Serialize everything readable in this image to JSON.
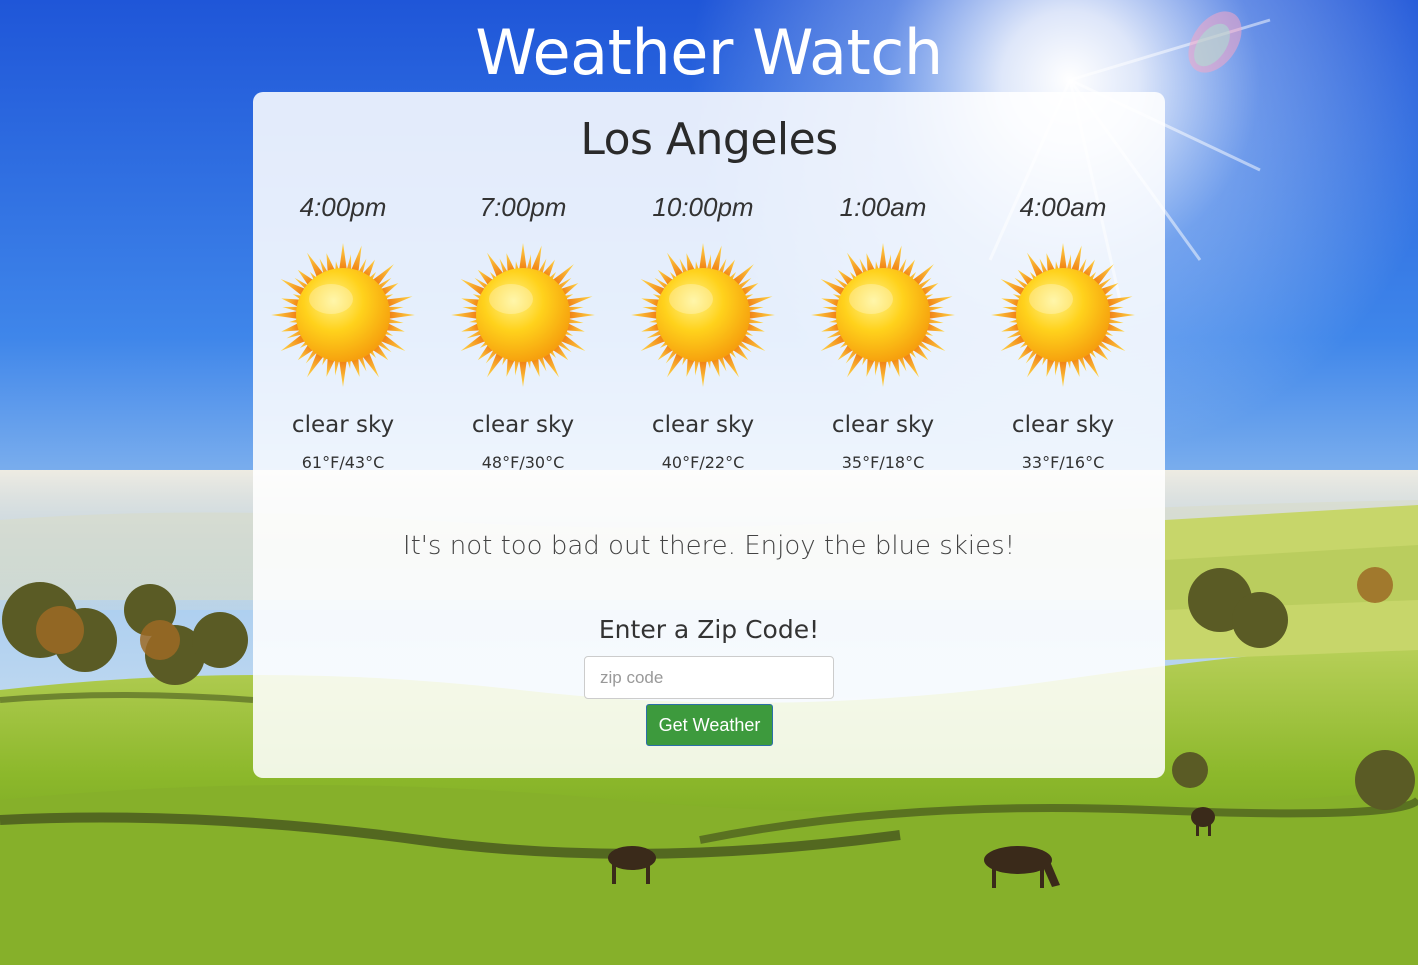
{
  "app_title": "Weather Watch",
  "city": "Los Angeles",
  "forecast": [
    {
      "time": "4:00pm",
      "icon": "sun-icon",
      "description": "clear sky",
      "temp": "61°F/43°C"
    },
    {
      "time": "7:00pm",
      "icon": "sun-icon",
      "description": "clear sky",
      "temp": "48°F/30°C"
    },
    {
      "time": "10:00pm",
      "icon": "sun-icon",
      "description": "clear sky",
      "temp": "40°F/22°C"
    },
    {
      "time": "1:00am",
      "icon": "sun-icon",
      "description": "clear sky",
      "temp": "35°F/18°C"
    },
    {
      "time": "4:00am",
      "icon": "sun-icon",
      "description": "clear sky",
      "temp": "33°F/16°C"
    }
  ],
  "message": "It's not too bad out there. Enjoy the blue skies!",
  "zip": {
    "label": "Enter a Zip Code!",
    "placeholder": "zip code",
    "value": "",
    "button_label": "Get Weather"
  },
  "colors": {
    "button": "#3d9a3d",
    "sky": "#2a64df",
    "field": "#8fbf2a"
  }
}
